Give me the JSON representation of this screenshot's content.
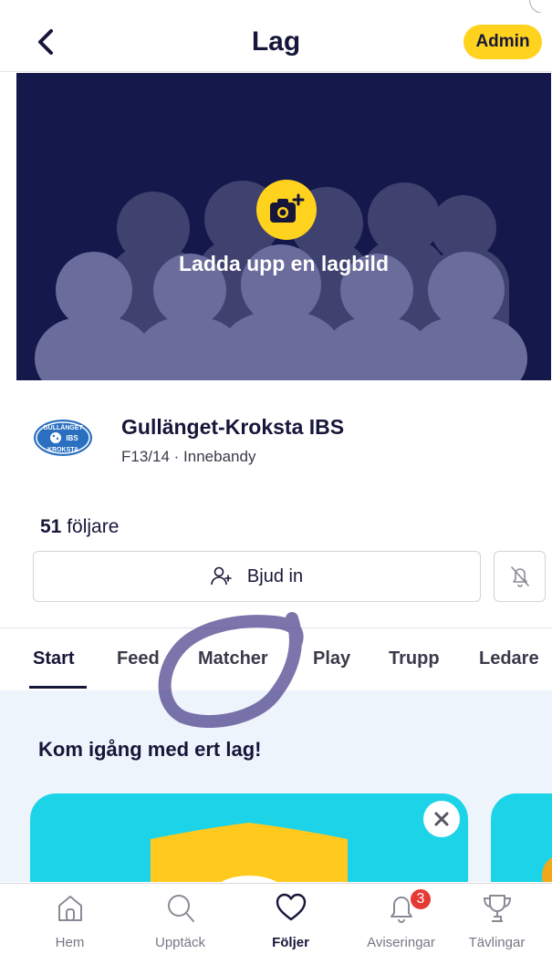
{
  "header": {
    "title": "Lag",
    "admin_label": "Admin"
  },
  "banner": {
    "upload_text": "Ladda upp en lagbild"
  },
  "team": {
    "name": "Gullänget-Kroksta IBS",
    "subtitle": "F13/14 · Innebandy",
    "logo_text_top": "GULLÄNGET",
    "logo_text_mid": "IBS",
    "logo_text_bottom": "KROKSTA"
  },
  "followers": {
    "count": "51",
    "label": "följare"
  },
  "invite": {
    "label": "Bjud in"
  },
  "tabs": [
    {
      "label": "Start"
    },
    {
      "label": "Feed"
    },
    {
      "label": "Matcher"
    },
    {
      "label": "Play"
    },
    {
      "label": "Trupp"
    },
    {
      "label": "Ledare"
    }
  ],
  "content": {
    "section_title": "Kom igång med ert lag!"
  },
  "bottom_nav": [
    {
      "label": "Hem",
      "icon": "home-icon"
    },
    {
      "label": "Upptäck",
      "icon": "search-icon"
    },
    {
      "label": "Följer",
      "icon": "heart-icon"
    },
    {
      "label": "Aviseringar",
      "icon": "bell-icon",
      "badge": "3"
    },
    {
      "label": "Tävlingar",
      "icon": "trophy-icon"
    }
  ],
  "colors": {
    "accent": "#ffd21e",
    "navy": "#15184a",
    "card": "#1dd3e8",
    "badge": "#e53935"
  }
}
